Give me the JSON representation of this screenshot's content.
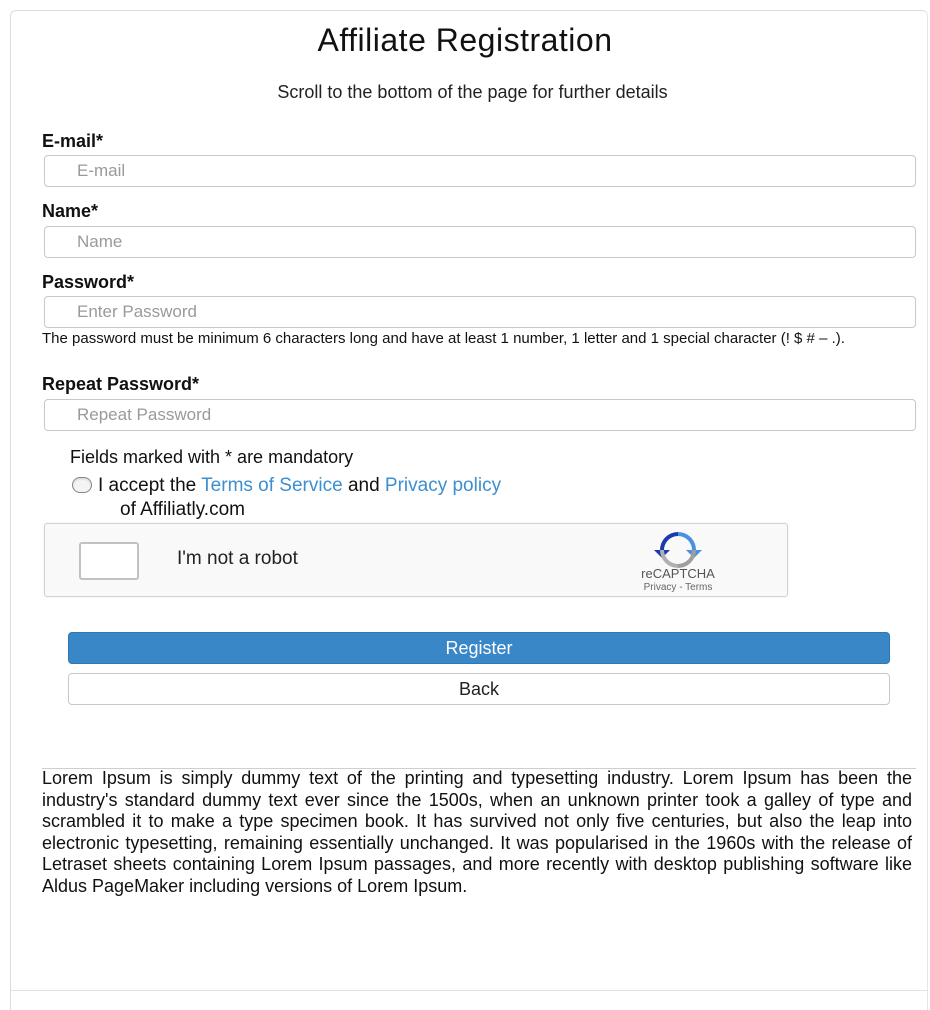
{
  "form": {
    "title": "Affiliate Registration",
    "subtitle": "Scroll to the bottom of the page for further details",
    "fields": [
      {
        "label": "E-mail*",
        "placeholder": "E-mail",
        "value": ""
      },
      {
        "label": "Name*",
        "placeholder": "Name",
        "value": ""
      },
      {
        "label": "Password*",
        "placeholder": "Enter Password",
        "value": ""
      },
      {
        "label": "Repeat Password*",
        "placeholder": "Repeat Password",
        "value": ""
      }
    ],
    "password_hint": "The password must be minimum 6 characters long and have at least 1 number, 1 letter and 1 special character (! $ # – .).",
    "mandatory_note": "Fields marked with * are mandatory",
    "terms": {
      "prefix": "I accept the",
      "tos_link": "Terms of Service",
      "and": "and",
      "privacy_link": "Privacy policy",
      "suffix": "of Affiliatly.com",
      "checked": false
    },
    "captcha": {
      "label": "I'm not a robot",
      "brand": "reCAPTCHA",
      "links": "Privacy - Terms",
      "checked": false
    },
    "register_label": "Register",
    "back_label": "Back"
  },
  "info_text": "Lorem Ipsum is simply dummy text of the printing and typesetting industry. Lorem Ipsum has been the industry's standard dummy text ever since the 1500s, when an unknown printer took a galley of type and scrambled it to make a type specimen book. It has survived not only five centuries, but also the leap into electronic typesetting, remaining essentially unchanged. It was popularised in the 1960s with the release of Letraset sheets containing Lorem Ipsum passages, and more recently with desktop publishing software like Aldus PageMaker including versions of Lorem Ipsum.",
  "colors": {
    "primary_button": "#3a87c8",
    "link": "#3c8fd0"
  },
  "icons": {
    "captcha_logo": "recaptcha-logo-icon"
  }
}
